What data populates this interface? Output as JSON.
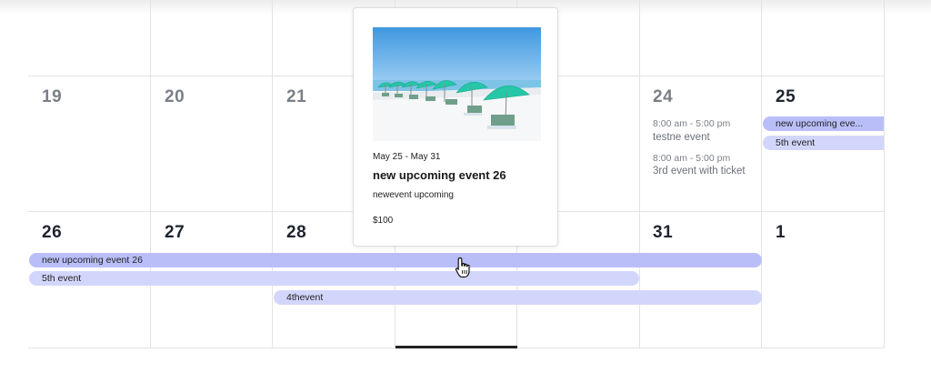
{
  "calendar": {
    "week1_days": [
      "19",
      "20",
      "21",
      "24",
      "25"
    ],
    "week2_days": [
      "26",
      "27",
      "28",
      "31",
      "1"
    ],
    "agenda_24": [
      {
        "time": "8:00 am - 5:00 pm",
        "title": "testne event"
      },
      {
        "time": "8:00 am - 5:00 pm",
        "title": "3rd event with ticket"
      }
    ],
    "bars_25": [
      "new upcoming eve...",
      "5th event"
    ],
    "bars_week2": [
      "new upcoming event 26",
      "5th event",
      "4thevent"
    ],
    "colors": {
      "bar_dark": "#babef8",
      "bar_light": "#d3d6fb",
      "today_underline": "#222222"
    }
  },
  "popup": {
    "date": "May 25 - May 31",
    "title": "new upcoming event 26",
    "description": "newevent upcoming",
    "price": "$100",
    "image": "beach-umbrellas-image"
  },
  "cursor": "hand-pointer-icon"
}
